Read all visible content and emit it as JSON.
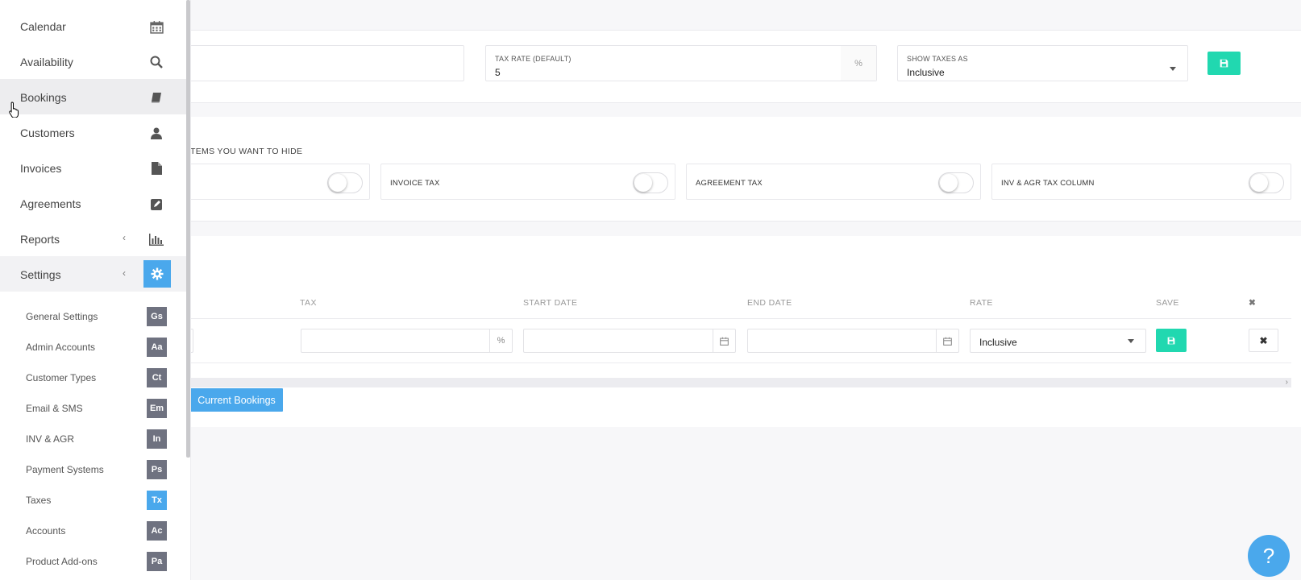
{
  "sidebar": {
    "nav": [
      {
        "label": "Calendar",
        "icon": "calendar-icon"
      },
      {
        "label": "Availability",
        "icon": "search-icon"
      },
      {
        "label": "Bookings",
        "icon": "book-icon"
      },
      {
        "label": "Customers",
        "icon": "user-icon"
      },
      {
        "label": "Invoices",
        "icon": "file-icon"
      },
      {
        "label": "Agreements",
        "icon": "edit-icon"
      },
      {
        "label": "Reports",
        "icon": "bar-chart-icon"
      },
      {
        "label": "Settings",
        "icon": "gear-icon"
      }
    ],
    "sub": [
      {
        "label": "General Settings",
        "badge": "Gs"
      },
      {
        "label": "Admin Accounts",
        "badge": "Aa"
      },
      {
        "label": "Customer Types",
        "badge": "Ct"
      },
      {
        "label": "Email & SMS",
        "badge": "Em"
      },
      {
        "label": "INV & AGR",
        "badge": "In"
      },
      {
        "label": "Payment Systems",
        "badge": "Ps"
      },
      {
        "label": "Taxes",
        "badge": "Tx"
      },
      {
        "label": "Accounts",
        "badge": "Ac"
      },
      {
        "label": "Product Add-ons",
        "badge": "Pa"
      }
    ],
    "active_sub": "Taxes"
  },
  "tax_defaults": {
    "tax_rate_label": "TAX RATE (DEFAULT)",
    "tax_rate_value": "5",
    "tax_rate_suffix": "%",
    "show_taxes_label": "SHOW TAXES AS",
    "show_taxes_value": "Inclusive"
  },
  "hide_section": {
    "title": "TEMS YOU WANT TO HIDE",
    "toggles": [
      {
        "label": "",
        "on": false
      },
      {
        "label": "INVOICE TAX",
        "on": false
      },
      {
        "label": "AGREEMENT TAX",
        "on": false
      },
      {
        "label": "INV & AGR TAX COLUMN",
        "on": false
      }
    ]
  },
  "tax_table": {
    "headers": [
      "TAX",
      "START DATE",
      "END DATE",
      "RATE",
      "SAVE"
    ],
    "row": {
      "tax_suffix": "%",
      "rate_value": "Inclusive"
    }
  },
  "current_bookings_label": "Current Bookings",
  "help_label": "?",
  "colors": {
    "accent_blue": "#4aa8ec",
    "save_green": "#21d8b0",
    "badge_gray": "#6f7280"
  }
}
